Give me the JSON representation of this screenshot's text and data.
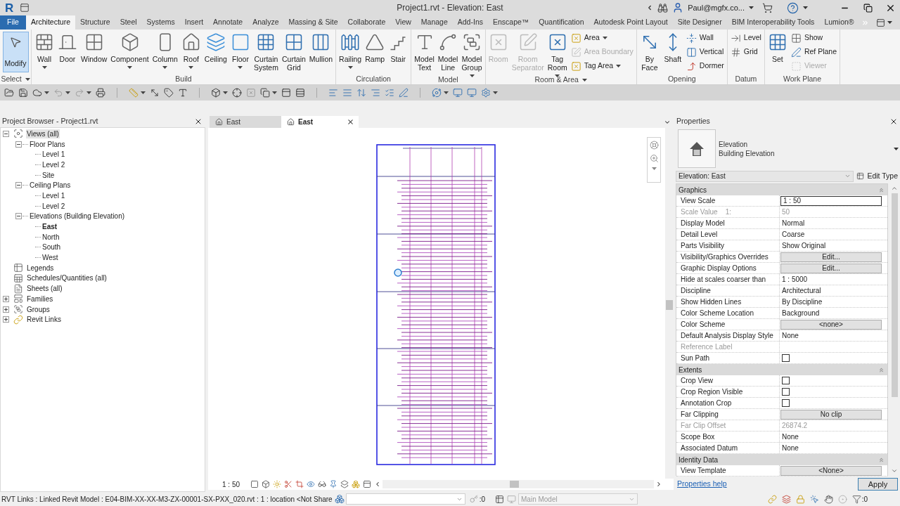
{
  "title_bar": {
    "logo": "R",
    "title": "Project1.rvt - Elevation: East",
    "user": "Paul@mgfx.co..."
  },
  "ribbon_tabs": {
    "file": "File",
    "tabs": [
      {
        "label": "Architecture",
        "selected": true
      },
      {
        "label": "Structure",
        "selected": false
      },
      {
        "label": "Steel",
        "selected": false
      },
      {
        "label": "Systems",
        "selected": false
      },
      {
        "label": "Insert",
        "selected": false
      },
      {
        "label": "Annotate",
        "selected": false
      },
      {
        "label": "Analyze",
        "selected": false
      },
      {
        "label": "Massing & Site",
        "selected": false
      },
      {
        "label": "Collaborate",
        "selected": false
      },
      {
        "label": "View",
        "selected": false
      },
      {
        "label": "Manage",
        "selected": false
      },
      {
        "label": "Add-Ins",
        "selected": false
      },
      {
        "label": "Enscape™",
        "selected": false
      },
      {
        "label": "Quantification",
        "selected": false
      },
      {
        "label": "Autodesk Point Layout",
        "selected": false
      },
      {
        "label": "Site Designer",
        "selected": false
      },
      {
        "label": "BIM Interoperability Tools",
        "selected": false
      },
      {
        "label": "Lumion®",
        "selected": false
      }
    ]
  },
  "ribbon": {
    "select_panel": {
      "tool": {
        "label": "Modify",
        "active": true
      },
      "label": "Select",
      "caret": true
    },
    "panels": [
      {
        "label": "Build",
        "caret": false,
        "items": [
          {
            "kind": "large",
            "label": "Wall",
            "caret": true,
            "disabled": false
          },
          {
            "kind": "large",
            "label": "Door",
            "caret": false,
            "disabled": false
          },
          {
            "kind": "large",
            "label": "Window",
            "caret": false,
            "disabled": false
          },
          {
            "kind": "large",
            "label": "Component",
            "caret": true,
            "disabled": false
          },
          {
            "kind": "large",
            "label": "Column",
            "caret": true,
            "disabled": false
          },
          {
            "kind": "large",
            "label": "Roof",
            "caret": true,
            "disabled": false
          },
          {
            "kind": "large",
            "label": "Ceiling",
            "caret": false,
            "disabled": false
          },
          {
            "kind": "large",
            "label": "Floor",
            "caret": true,
            "disabled": false
          },
          {
            "kind": "large",
            "label": "Curtain System",
            "caret": false,
            "disabled": false
          },
          {
            "kind": "large",
            "label": "Curtain Grid",
            "caret": false,
            "disabled": false
          },
          {
            "kind": "large",
            "label": "Mullion",
            "caret": false,
            "disabled": false
          }
        ]
      },
      {
        "label": "Circulation",
        "caret": false,
        "items": [
          {
            "kind": "large",
            "label": "Railing",
            "caret": true,
            "disabled": false
          },
          {
            "kind": "large",
            "label": "Ramp",
            "caret": false,
            "disabled": false
          },
          {
            "kind": "large",
            "label": "Stair",
            "caret": false,
            "disabled": false
          }
        ]
      },
      {
        "label": "Model",
        "caret": false,
        "items": [
          {
            "kind": "large",
            "label": "Model Text",
            "caret": false,
            "disabled": false
          },
          {
            "kind": "large",
            "label": "Model Line",
            "caret": false,
            "disabled": false
          },
          {
            "kind": "large",
            "label": "Model Group",
            "caret": true,
            "disabled": false
          }
        ]
      },
      {
        "label": "Room & Area",
        "caret": true,
        "items": [
          {
            "kind": "large",
            "label": "Room",
            "caret": false,
            "disabled": true
          },
          {
            "kind": "large",
            "label": "Room Separator",
            "caret": false,
            "disabled": true
          },
          {
            "kind": "large",
            "label": "Tag Room",
            "caret": true,
            "disabled": false
          },
          {
            "kind": "stack",
            "items": [
              {
                "label": "Area",
                "caret": true,
                "disabled": false
              },
              {
                "label": "Area Boundary",
                "caret": false,
                "disabled": true
              },
              {
                "label": "Tag Area",
                "caret": true,
                "disabled": false
              }
            ]
          }
        ]
      },
      {
        "label": "Opening",
        "caret": false,
        "items": [
          {
            "kind": "large",
            "label": "By Face",
            "caret": false,
            "disabled": false
          },
          {
            "kind": "large",
            "label": "Shaft",
            "caret": false,
            "disabled": false
          },
          {
            "kind": "stack",
            "items": [
              {
                "label": "Wall",
                "caret": false,
                "disabled": false
              },
              {
                "label": "Vertical",
                "caret": false,
                "disabled": false
              },
              {
                "label": "Dormer",
                "caret": false,
                "disabled": false
              }
            ]
          }
        ]
      },
      {
        "label": "Datum",
        "caret": false,
        "items": [
          {
            "kind": "stack",
            "items": [
              {
                "label": "Level",
                "caret": false,
                "disabled": false
              },
              {
                "label": "Grid",
                "caret": false,
                "disabled": false
              }
            ]
          }
        ]
      },
      {
        "label": "Work Plane",
        "caret": false,
        "items": [
          {
            "kind": "large",
            "label": "Set",
            "caret": false,
            "disabled": false
          },
          {
            "kind": "stack",
            "items": [
              {
                "label": "Show",
                "caret": false,
                "disabled": false
              },
              {
                "label": "Ref Plane",
                "caret": false,
                "disabled": false
              },
              {
                "label": "Viewer",
                "caret": false,
                "disabled": true
              }
            ]
          }
        ]
      }
    ]
  },
  "project_browser": {
    "title": "Project Browser - Project1.rvt",
    "tree": [
      {
        "label": "Views (all)",
        "expanded": true,
        "selected": true,
        "current": false,
        "children": [
          {
            "label": "Floor Plans",
            "expanded": true,
            "selected": false,
            "current": false,
            "children": [
              {
                "label": "Level 1",
                "selected": false,
                "current": false
              },
              {
                "label": "Level 2",
                "selected": false,
                "current": false
              },
              {
                "label": "Site",
                "selected": false,
                "current": false
              }
            ]
          },
          {
            "label": "Ceiling Plans",
            "expanded": true,
            "selected": false,
            "current": false,
            "children": [
              {
                "label": "Level 1",
                "selected": false,
                "current": false
              },
              {
                "label": "Level 2",
                "selected": false,
                "current": false
              }
            ]
          },
          {
            "label": "Elevations (Building Elevation)",
            "expanded": true,
            "selected": false,
            "current": false,
            "children": [
              {
                "label": "East",
                "selected": false,
                "current": true
              },
              {
                "label": "North",
                "selected": false,
                "current": false
              },
              {
                "label": "South",
                "selected": false,
                "current": false
              },
              {
                "label": "West",
                "selected": false,
                "current": false
              }
            ]
          }
        ]
      },
      {
        "label": "Legends",
        "selected": false,
        "current": false
      },
      {
        "label": "Schedules/Quantities (all)",
        "selected": false,
        "current": false
      },
      {
        "label": "Sheets (all)",
        "selected": false,
        "current": false
      },
      {
        "label": "Families",
        "expanded": false,
        "selected": false,
        "current": false
      },
      {
        "label": "Groups",
        "expanded": false,
        "selected": false,
        "current": false
      },
      {
        "label": "Revit Links",
        "expanded": false,
        "selected": false,
        "current": false
      }
    ]
  },
  "view": {
    "tabs": [
      {
        "label": "East",
        "selected": false,
        "closable": false
      },
      {
        "label": "East",
        "selected": true,
        "closable": true
      }
    ],
    "scale": "1 : 50"
  },
  "properties": {
    "title": "Properties",
    "type_selector": {
      "family": "Elevation",
      "type": "Building Elevation"
    },
    "instance": "Elevation: East",
    "edit_type": "Edit Type",
    "sections": [
      {
        "title": "Graphics",
        "expanded": true,
        "rows": [
          {
            "kind": "input",
            "label": "View Scale",
            "value": "1 : 50",
            "disabled": false
          },
          {
            "kind": "text",
            "label": "Scale Value    1:",
            "value": "50",
            "disabled": true
          },
          {
            "kind": "text",
            "label": "Display Model",
            "value": "Normal",
            "disabled": false
          },
          {
            "kind": "text",
            "label": "Detail Level",
            "value": "Coarse",
            "disabled": false
          },
          {
            "kind": "text",
            "label": "Parts Visibility",
            "value": "Show Original",
            "disabled": false
          },
          {
            "kind": "button",
            "label": "Visibility/Graphics Overrides",
            "value": "Edit...",
            "disabled": false
          },
          {
            "kind": "button",
            "label": "Graphic Display Options",
            "value": "Edit...",
            "disabled": false
          },
          {
            "kind": "text",
            "label": "Hide at scales coarser than",
            "value": "1 : 5000",
            "disabled": false
          },
          {
            "kind": "text",
            "label": "Discipline",
            "value": "Architectural",
            "disabled": false
          },
          {
            "kind": "text",
            "label": "Show Hidden Lines",
            "value": "By Discipline",
            "disabled": false
          },
          {
            "kind": "text",
            "label": "Color Scheme Location",
            "value": "Background",
            "disabled": false
          },
          {
            "kind": "button",
            "label": "Color Scheme",
            "value": "<none>",
            "disabled": false
          },
          {
            "kind": "text",
            "label": "Default Analysis Display Style",
            "value": "None",
            "disabled": false
          },
          {
            "kind": "text",
            "label": "Reference Label",
            "disabled": true
          },
          {
            "kind": "checkbox",
            "label": "Sun Path",
            "checked": false,
            "disabled": false
          }
        ]
      },
      {
        "title": "Extents",
        "expanded": true,
        "rows": [
          {
            "kind": "checkbox",
            "label": "Crop View",
            "checked": false,
            "disabled": false
          },
          {
            "kind": "checkbox",
            "label": "Crop Region Visible",
            "checked": false,
            "disabled": false
          },
          {
            "kind": "checkbox",
            "label": "Annotation Crop",
            "checked": false,
            "disabled": false
          },
          {
            "kind": "button",
            "label": "Far Clipping",
            "value": "No clip",
            "disabled": false
          },
          {
            "kind": "text",
            "label": "Far Clip Offset",
            "value": "26874.2",
            "disabled": true
          },
          {
            "kind": "text",
            "label": "Scope Box",
            "value": "None",
            "disabled": false
          },
          {
            "kind": "text",
            "label": "Associated Datum",
            "value": "None",
            "disabled": false
          }
        ]
      },
      {
        "title": "Identity Data",
        "expanded": true,
        "rows": [
          {
            "kind": "button",
            "label": "View Template",
            "value": "<None>",
            "disabled": false
          }
        ]
      }
    ],
    "help_link": "Properties help",
    "apply": "Apply"
  },
  "status_bar": {
    "message": "RVT Links : Linked Revit Model : E04-BIM-XX-XX-M3-ZX-00001-SX-PXX_020.rvt : 1 : location <Not Share",
    "editable_count": ":0",
    "design_option": {
      "value": "Main Model",
      "disabled": true
    },
    "filter_count": ":0"
  }
}
